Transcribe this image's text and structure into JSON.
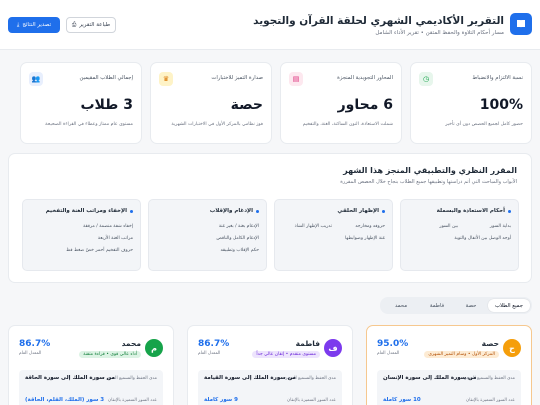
{
  "header": {
    "title": "التقرير الأكاديمي الشهري لحلقة القرآن والتجويد",
    "subtitle": "مسار أحكام التلاوة والحفظ المتقن • تقرير الأداء الشامل",
    "export_label": "تصدير النتائج",
    "print_label": "طباعة التقرير"
  },
  "stats": [
    {
      "label": "نسبة الالتزام والانضباط",
      "value": "100%",
      "desc": "حضور كامل لجميع الحصص دون أي تأخير"
    },
    {
      "label": "المحاور التجويدية المنجزة",
      "value": "6 محاور",
      "desc": "شملت الاستعاذة، النون الساكنة، الغنة، والتفخيم"
    },
    {
      "label": "صدارة التميز للاختبارات",
      "value": "حصة",
      "desc": "فوز نظامي بالمركز الأول في الاختبارات الشهرية"
    },
    {
      "label": "إجمالي الطلاب المقيمين",
      "value": "3 طلاب",
      "desc": "مستوى عام ممتاز وعطاء في القراءة الصحيحة"
    }
  ],
  "curriculum": {
    "title": "المقرر النظري والتطبيقي المنجز هذا الشهر",
    "subtitle": "الأبواب والمباحث التي أتم دراستها وتطبيقها جميع الطلاب بنجاح خلال الحصص المقررة",
    "units": [
      {
        "title": "أحكام الاستعاذة والبسملة",
        "items": [
          "بداية السور",
          "بين السور",
          "أوجه الوصل بين الأنفال والتوبة"
        ]
      },
      {
        "title": "الإظهار الحلقي",
        "items": [
          "حروفه ومخارجه",
          "تدريب الإظهار الشاذ",
          "غنة الإظهار وضوابطها"
        ]
      },
      {
        "title": "الإدغام والإقلاب",
        "items": [
          "الإدغام بغنة / بغير غنة",
          "الإدغام الكامل والناقص",
          "حكم الإقلاب وتطبيقه"
        ]
      },
      {
        "title": "الإخفاء ومراتب الغنة والتفخيم",
        "items": [
          "إخفاء شفة منضمة / مرققة",
          "مراتب الغنة الأربعة",
          "حروف التفخيم أحمر خضّ ضغط قظ"
        ]
      }
    ]
  },
  "tabs": [
    "جميع الطلاب",
    "حصة",
    "فاطمة",
    "محمد"
  ],
  "students": [
    {
      "initial": "ح",
      "name": "حصة",
      "badge": "المركز الأول • وسام التميز الشهري",
      "pct": "95.0%",
      "pct_label": "المعدل العام",
      "k1": "مدى الحفظ والتسميع المنجز",
      "v1": "من سورة الملك إلى سورة الإنسان",
      "k2": "عدد السور المتميزة بالإتقان",
      "v2": "10 سور كاملة"
    },
    {
      "initial": "ف",
      "name": "فاطمة",
      "badge": "مستوى متقدم • إتقان عالي جداً",
      "pct": "86.7%",
      "pct_label": "المعدل العام",
      "k1": "مدى الحفظ والتسميع المنجز",
      "v1": "من سورة الملك إلى سورة القيامة",
      "k2": "عدد السور المتميزة بالإتقان",
      "v2": "9 سور كاملة"
    },
    {
      "initial": "م",
      "name": "محمد",
      "badge": "أداء عالي قوي • قراءة متقنة",
      "pct": "86.7%",
      "pct_label": "المعدل العام",
      "k1": "مدى الحفظ والتسميع المنجز",
      "v1": "من سورة الملك إلى سورة الحاقة",
      "k2": "عدد السور المتميزة بالإتقان",
      "v2": "3 سور (الملك، القلم، الحاقة)"
    }
  ],
  "colors": {
    "primary": "#1f6feb",
    "gold": "#f59e0b",
    "purple": "#7c3aed",
    "green": "#16a34a"
  }
}
